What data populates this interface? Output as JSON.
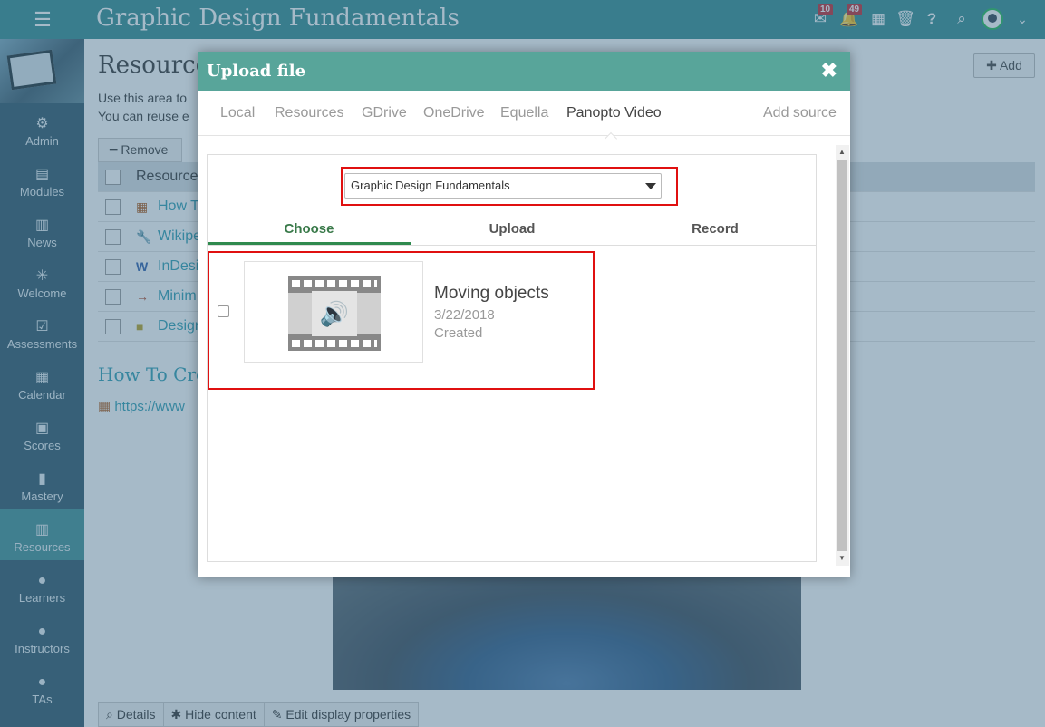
{
  "app": {
    "title": "Graphic Design Fundamentals",
    "badges": {
      "messages": "10",
      "notifications": "49"
    }
  },
  "sidebar": {
    "items": [
      {
        "label": "Admin"
      },
      {
        "label": "Modules"
      },
      {
        "label": "News"
      },
      {
        "label": "Welcome"
      },
      {
        "label": "Assessments"
      },
      {
        "label": "Calendar"
      },
      {
        "label": "Scores"
      },
      {
        "label": "Mastery"
      },
      {
        "label": "Resources",
        "active": true
      },
      {
        "label": "Learners"
      },
      {
        "label": "Instructors"
      },
      {
        "label": "TAs"
      }
    ]
  },
  "main": {
    "heading": "Resource",
    "desc1": "Use this area to",
    "desc2": "You can reuse e",
    "add_label": "Add",
    "remove_label": "Remove",
    "table_head": "Resource",
    "rows": [
      {
        "label": "How T"
      },
      {
        "label": "Wikipe"
      },
      {
        "label": "InDesi"
      },
      {
        "label": "Minim"
      },
      {
        "label": "Design"
      }
    ],
    "section_title": "How To Cre",
    "url": "https://www",
    "bottom": {
      "details": "Details",
      "hide": "Hide content",
      "edit": "Edit display properties"
    }
  },
  "modal": {
    "title": "Upload file",
    "close": "✖",
    "sources": [
      "Local",
      "Resources",
      "GDrive",
      "OneDrive",
      "Equella",
      "Panopto Video"
    ],
    "add_source": "Add source",
    "folder": "Graphic Design Fundamentals",
    "tabs": {
      "choose": "Choose",
      "upload": "Upload",
      "record": "Record"
    },
    "item": {
      "title": "Moving objects",
      "date": "3/22/2018",
      "status": "Created"
    }
  },
  "colors": {
    "topbar": "#2f8a8f",
    "sidebar": "#2b5466",
    "modal_header": "#58a59a",
    "highlight": "#e01010"
  }
}
